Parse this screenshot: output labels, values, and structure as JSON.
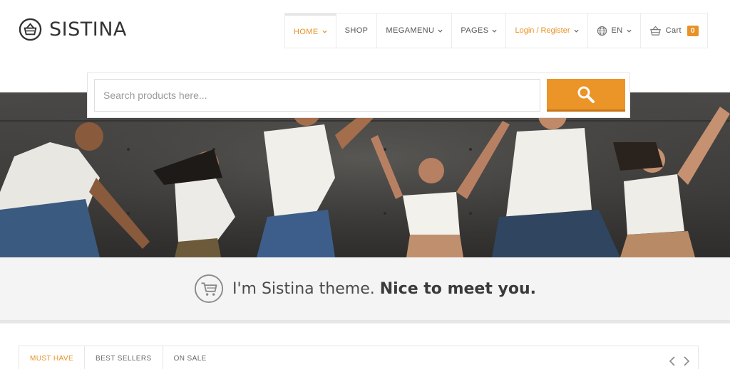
{
  "brand": {
    "name": "SISTINA",
    "logo_icon": "basket-circle-icon"
  },
  "nav": {
    "items": [
      {
        "label": "HOME",
        "has_dropdown": true,
        "active": true
      },
      {
        "label": "SHOP",
        "has_dropdown": false
      },
      {
        "label": "MEGAMENU",
        "has_dropdown": true
      },
      {
        "label": "PAGES",
        "has_dropdown": true
      }
    ],
    "login_label": "Login / Register",
    "language": "EN",
    "cart_label": "Cart",
    "cart_count": "0"
  },
  "search": {
    "placeholder": "Search products here...",
    "button_icon": "search-icon"
  },
  "welcome": {
    "text_light": "I'm Sistina theme.",
    "text_bold": "Nice to meet you.",
    "icon": "cart-circle-icon"
  },
  "tabs": [
    {
      "label": "MUST HAVE",
      "active": true
    },
    {
      "label": "BEST SELLERS",
      "active": false
    },
    {
      "label": "ON SALE",
      "active": false
    }
  ],
  "colors": {
    "accent": "#e89225",
    "button": "#eb9427",
    "band": "#f4f4f4"
  }
}
